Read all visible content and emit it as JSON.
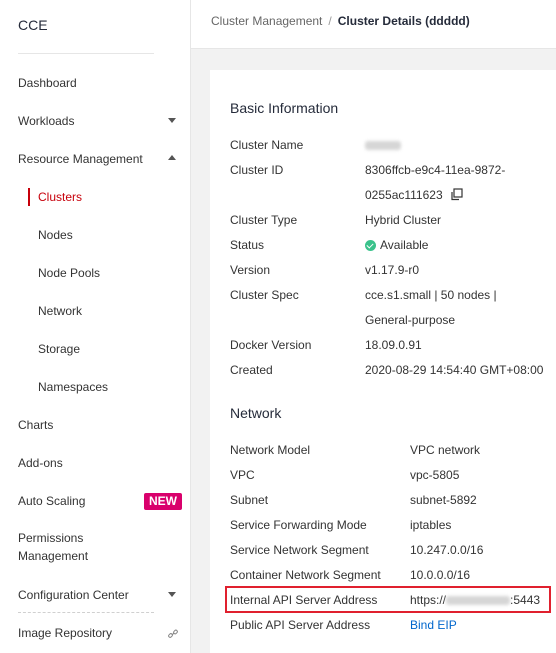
{
  "app": {
    "name": "CCE"
  },
  "sidebar": {
    "items": [
      {
        "label": "Dashboard"
      },
      {
        "label": "Workloads"
      },
      {
        "label": "Resource Management"
      },
      {
        "label": "Clusters"
      },
      {
        "label": "Nodes"
      },
      {
        "label": "Node Pools"
      },
      {
        "label": "Network"
      },
      {
        "label": "Storage"
      },
      {
        "label": "Namespaces"
      },
      {
        "label": "Charts"
      },
      {
        "label": "Add-ons"
      },
      {
        "label": "Auto Scaling",
        "badge": "NEW"
      },
      {
        "label": "Permissions",
        "label2": "Management"
      },
      {
        "label": "Configuration Center"
      },
      {
        "label": "Image Repository"
      }
    ]
  },
  "breadcrumb": {
    "parent": "Cluster Management",
    "separator": "/",
    "current": "Cluster Details (ddddd)"
  },
  "basic": {
    "title": "Basic Information",
    "cluster_name_label": "Cluster Name",
    "cluster_id_label": "Cluster ID",
    "cluster_id_line1": "8306ffcb-e9c4-11ea-9872-",
    "cluster_id_line2": "0255ac111623",
    "cluster_type_label": "Cluster Type",
    "cluster_type": "Hybrid Cluster",
    "status_label": "Status",
    "status": "Available",
    "version_label": "Version",
    "version": "v1.17.9-r0",
    "spec_label": "Cluster Spec",
    "spec_line1": "cce.s1.small | 50 nodes |",
    "spec_line2": "General-purpose",
    "docker_label": "Docker Version",
    "docker": "18.09.0.91",
    "created_label": "Created",
    "created": "2020-08-29 14:54:40 GMT+08:00"
  },
  "network": {
    "title": "Network",
    "model_label": "Network Model",
    "model": "VPC network",
    "vpc_label": "VPC",
    "vpc": "vpc-5805",
    "subnet_label": "Subnet",
    "subnet": "subnet-5892",
    "forwarding_label": "Service Forwarding Mode",
    "forwarding": "iptables",
    "service_segment_label": "Service Network Segment",
    "service_segment": "10.247.0.0/16",
    "container_segment_label": "Container Network Segment",
    "container_segment": "10.0.0.0/16",
    "internal_api_label": "Internal API Server Address",
    "internal_api_prefix": "https://",
    "internal_api_suffix": ":5443",
    "public_api_label": "Public API Server Address",
    "public_api_link": "Bind EIP"
  },
  "colors": {
    "accent": "#c7000b",
    "badge": "#d9006c",
    "link": "#0066cc",
    "available": "#3ac28b",
    "highlight_border": "#e0202e"
  }
}
